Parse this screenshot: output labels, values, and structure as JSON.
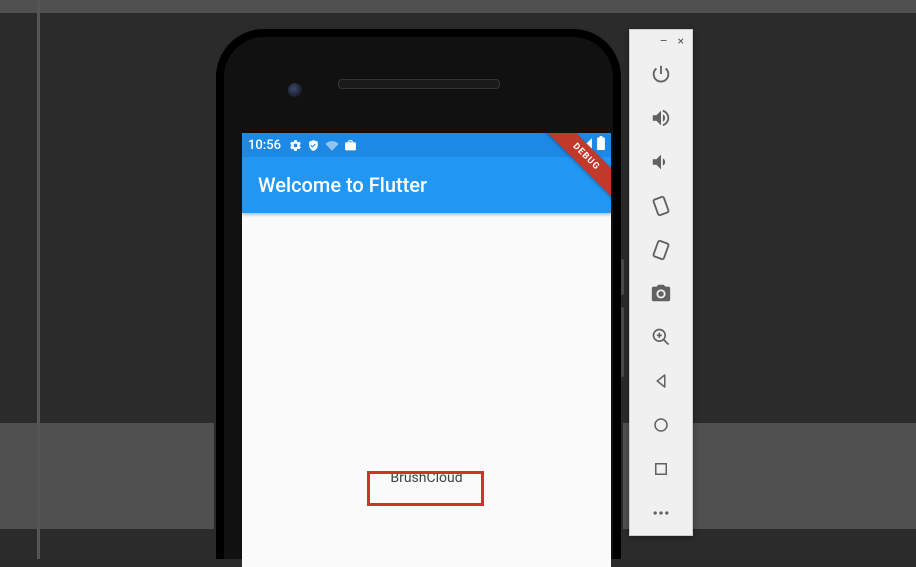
{
  "statusbar": {
    "clock": "10:56",
    "icons": [
      "settings",
      "shield",
      "wifi",
      "briefcase"
    ],
    "right_icons": [
      "signal",
      "battery"
    ],
    "debug_banner": "DEBUG"
  },
  "appbar": {
    "title": "Welcome to Flutter"
  },
  "body": {
    "center_text": "BrushCloud"
  },
  "toolbar": {
    "window_controls": {
      "minimize": "–",
      "close": "×"
    },
    "buttons": [
      "power",
      "volume-up",
      "volume-down",
      "rotate-left",
      "rotate-right",
      "screenshot",
      "zoom-in",
      "back",
      "home",
      "overview",
      "more"
    ]
  },
  "colors": {
    "appbar_bg": "#2196f3",
    "statusbar_bg": "#1e88e5",
    "highlight": "#d32f2f",
    "body_bg": "#fafafa"
  }
}
